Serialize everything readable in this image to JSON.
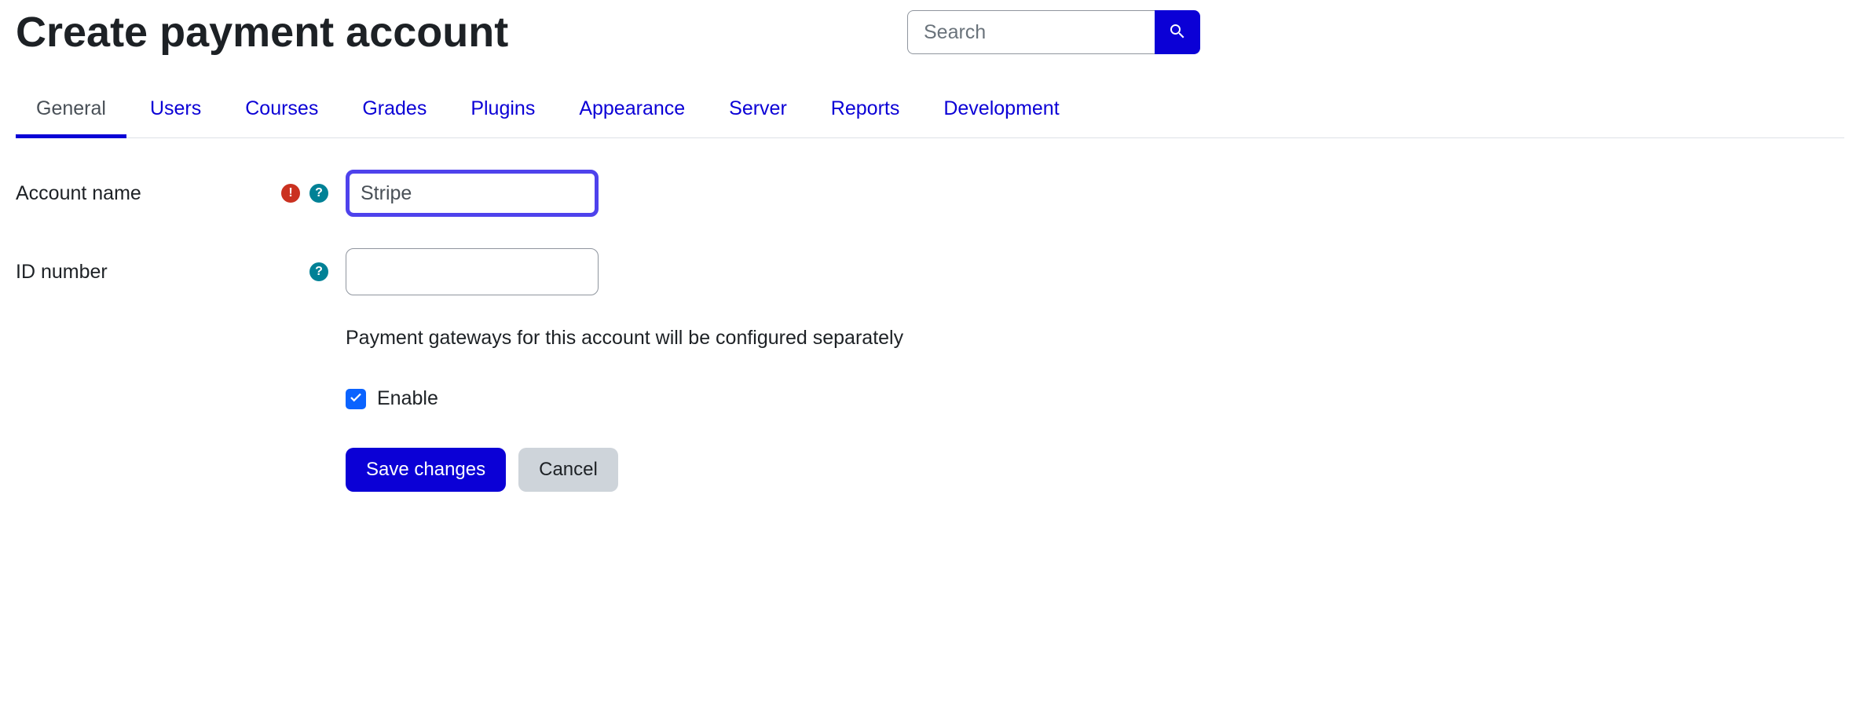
{
  "header": {
    "title": "Create payment account",
    "search_placeholder": "Search"
  },
  "tabs": [
    {
      "label": "General",
      "active": true
    },
    {
      "label": "Users"
    },
    {
      "label": "Courses"
    },
    {
      "label": "Grades"
    },
    {
      "label": "Plugins"
    },
    {
      "label": "Appearance"
    },
    {
      "label": "Server"
    },
    {
      "label": "Reports"
    },
    {
      "label": "Development"
    }
  ],
  "form": {
    "account_name": {
      "label": "Account name",
      "value": "Stripe",
      "required": true
    },
    "id_number": {
      "label": "ID number",
      "value": "",
      "required": false
    },
    "info_text": "Payment gateways for this account will be configured separately",
    "enable": {
      "label": "Enable",
      "checked": true
    },
    "save_label": "Save changes",
    "cancel_label": "Cancel"
  }
}
